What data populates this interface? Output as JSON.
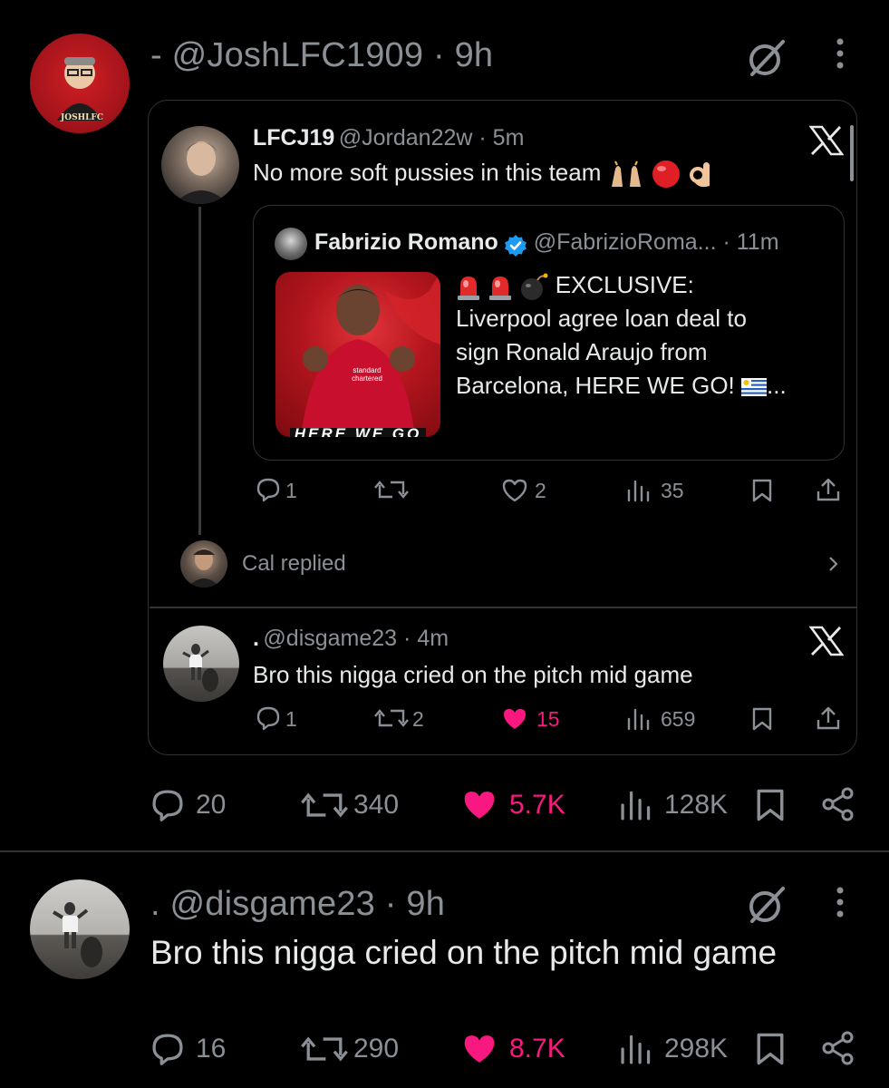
{
  "main_tweet": {
    "author_prefix": "-",
    "handle": "@JoshLFC1909",
    "separator": "·",
    "time": "9h",
    "avatar_text": "JOSHLFC",
    "stats": {
      "replies": "20",
      "retweets": "340",
      "likes": "5.7K",
      "views": "128K"
    },
    "colors": {
      "like": "#f91880",
      "muted": "#8b9096",
      "border": "#2f3336"
    }
  },
  "embed_thread": {
    "top": {
      "name": "LFCJ19",
      "handle": "@Jordan22w",
      "time": "5m",
      "text": "No more soft pussies in this team",
      "stats": {
        "replies": "1",
        "retweets": "",
        "likes": "2",
        "views": "35"
      }
    },
    "quoted": {
      "name": "Fabrizio Romano",
      "handle": "@FabrizioRoma...",
      "time": "11m",
      "headline": "EXCLUSIVE:",
      "text_line1": "Liverpool agree loan deal to",
      "text_line2": "sign Ronald Araujo from",
      "text_line3": "Barcelona, HERE WE GO!",
      "text_tail": "...",
      "media_caption": "HERE WE GO",
      "shirt_sponsor": "standard chartered"
    },
    "cal_replied": "Cal replied",
    "reply": {
      "name": ".",
      "handle": "@disgame23",
      "time": "4m",
      "text": "Bro this nigga cried on the pitch mid game",
      "stats": {
        "replies": "1",
        "retweets": "2",
        "likes": "15",
        "views": "659"
      }
    }
  },
  "second_tweet": {
    "name": ".",
    "handle": "@disgame23",
    "separator": "·",
    "time": "9h",
    "text": "Bro this nigga cried on the pitch mid game",
    "stats": {
      "replies": "16",
      "retweets": "290",
      "likes": "8.7K",
      "views": "298K"
    }
  }
}
